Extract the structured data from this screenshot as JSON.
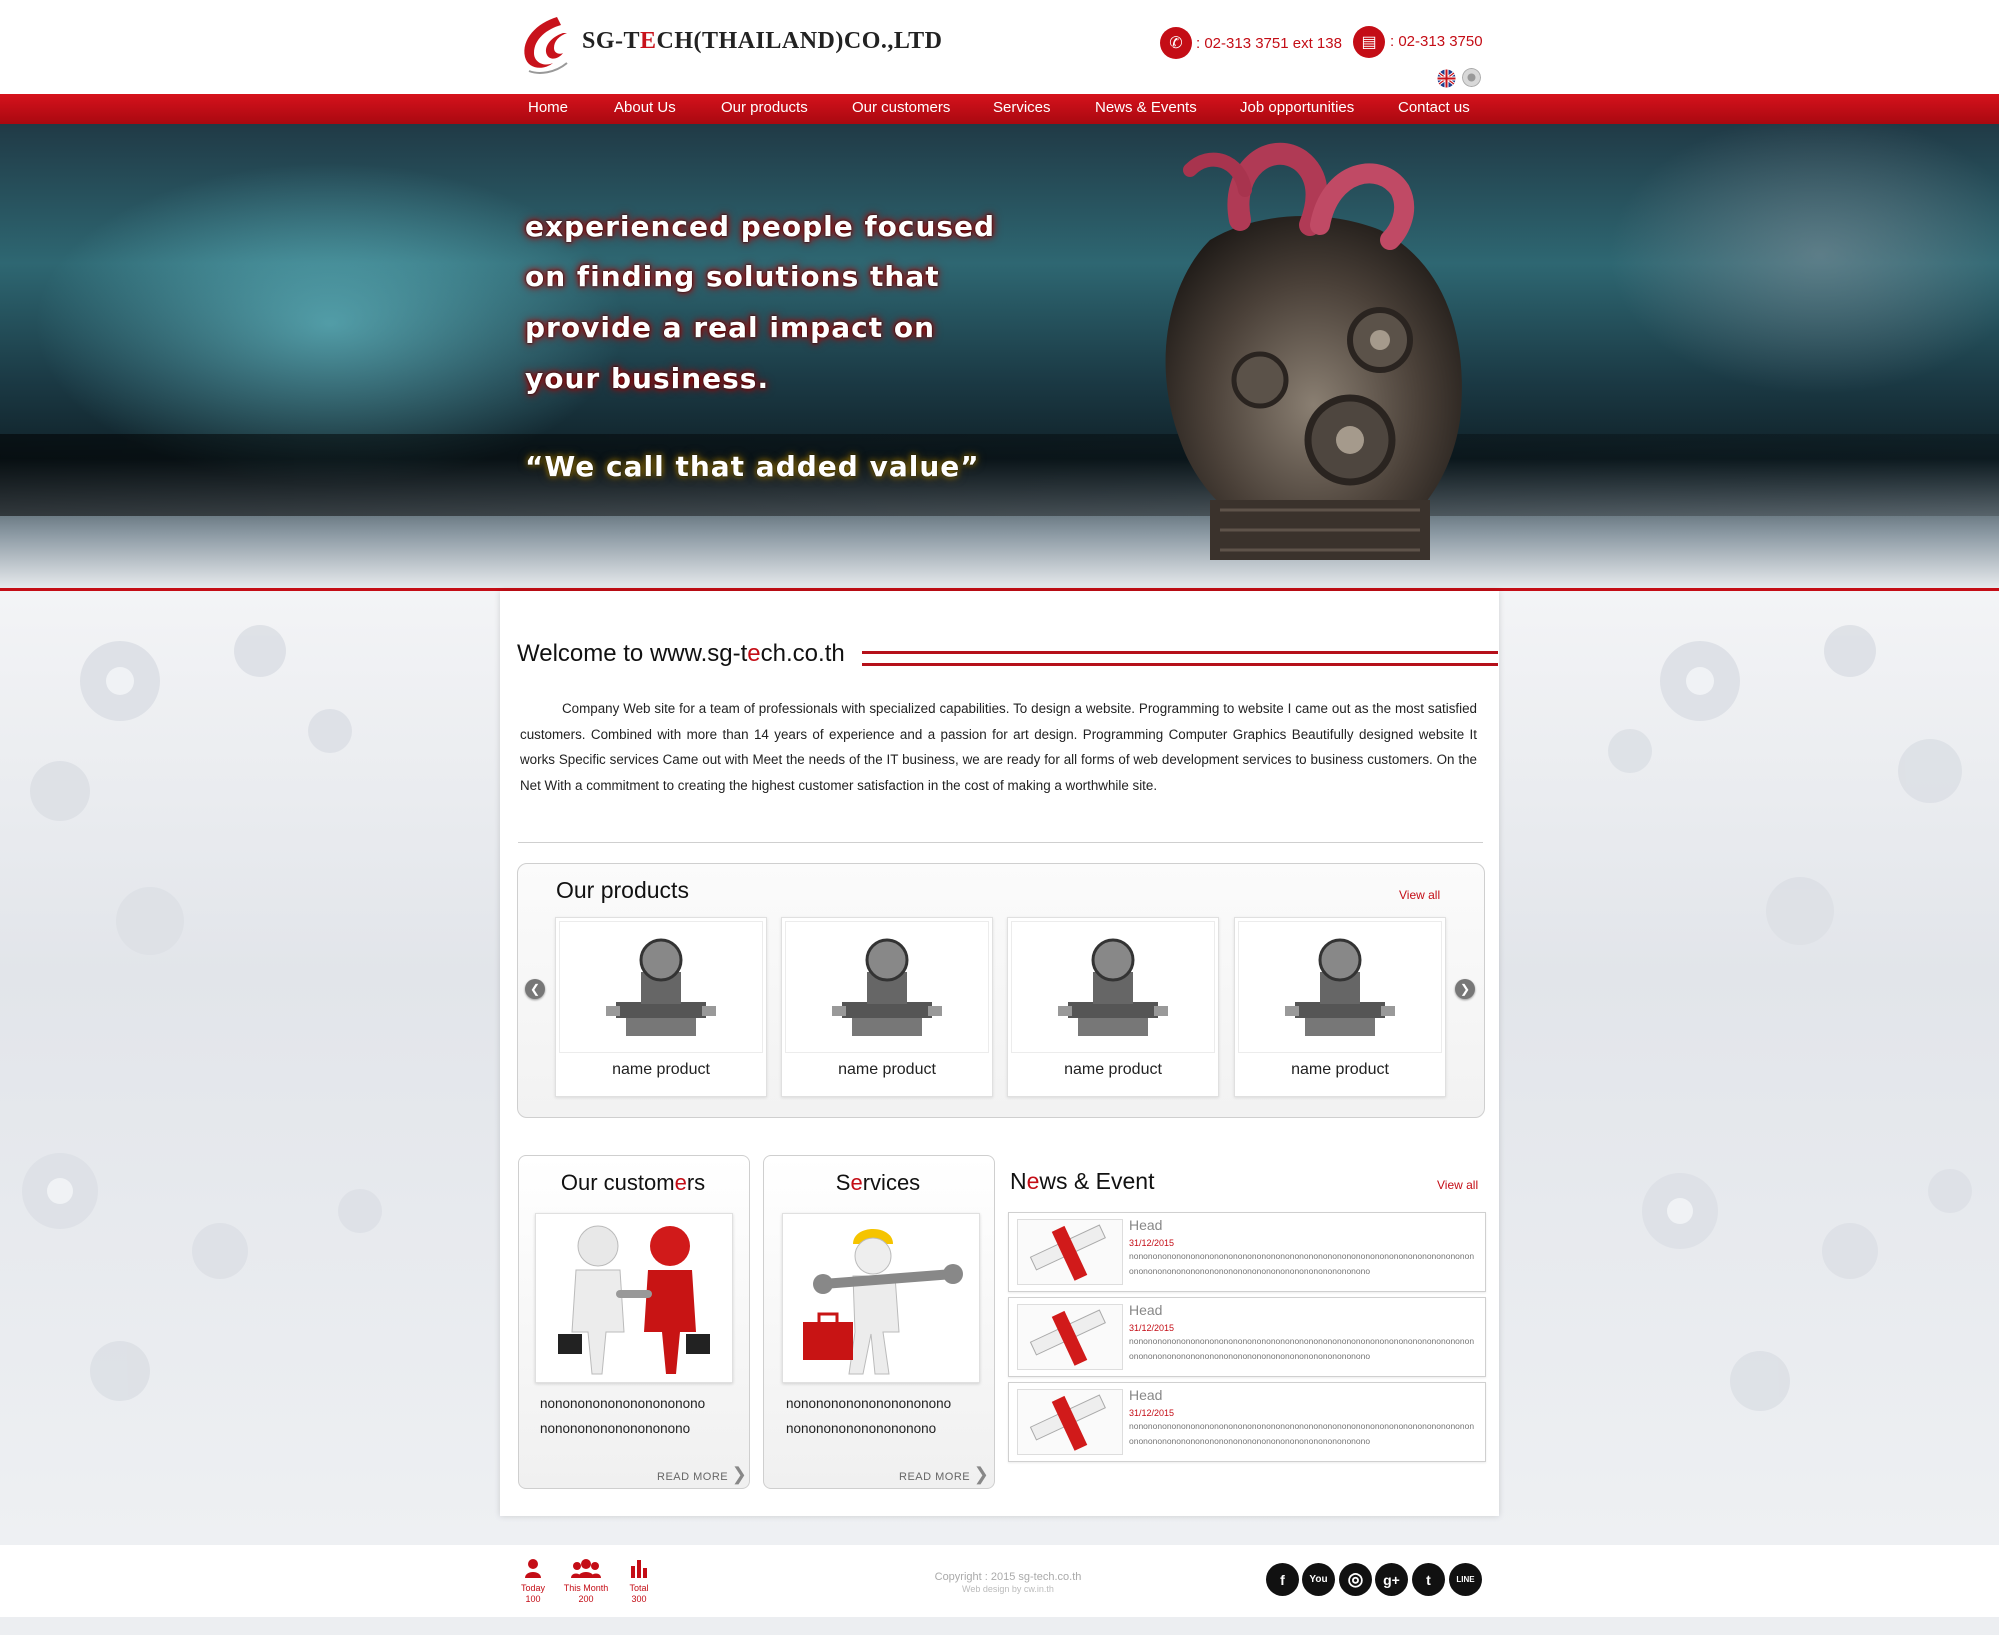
{
  "header": {
    "logo_text_pre": "SG-T",
    "logo_text_e": "E",
    "logo_text_post": "CH(THAILAND)CO.,LTD",
    "phone": ": 02-313 3751 ext 138",
    "fax": ": 02-313 3750"
  },
  "nav": {
    "items": [
      "Home",
      "About Us",
      "Our products",
      "Our customers",
      "Services",
      "News & Events",
      "Job opportunities",
      "Contact us"
    ]
  },
  "hero": {
    "lines": [
      "experienced people focused",
      "on finding solutions that",
      "provide a real impact on",
      "your business."
    ],
    "tagline": "“We call that added value”"
  },
  "welcome": {
    "title_pre": "Welcome to www.sg-t",
    "title_e": "e",
    "title_post": "ch.co.th",
    "body": "Company Web site for a team of professionals with specialized capabilities. To design a website. Programming to website I came out as the most satisfied customers. Combined with more than 14 years of experience and a passion for art design. Programming Computer Graphics Beautifully designed website It works Specific services Came out with Meet the needs of the IT business, we are ready for all forms of web development services to business customers. On the Net With a commitment to creating the highest customer satisfaction in the cost of making a worthwhile site."
  },
  "products": {
    "title": "Our products",
    "view_all": "View all",
    "items": [
      "name  product",
      "name  product",
      "name  product",
      "name  product"
    ]
  },
  "customers": {
    "title_pre": "Our custom",
    "title_e": "e",
    "title_post": "rs",
    "text_line1": "nonononononononononono",
    "text_line2": "nononononononononono",
    "read_more": "READ MORE"
  },
  "services": {
    "title_pre": "S",
    "title_e": "e",
    "title_post": "rvices",
    "text_line1": "nonononononononononono",
    "text_line2": "nononononononononono",
    "read_more": "READ MORE"
  },
  "news": {
    "title_pre": "N",
    "title_e": "e",
    "title_post": "ws & Event",
    "view_all": "View all",
    "items": [
      {
        "head": "Head",
        "date": "31/12/2015",
        "desc": "nononononononononononononononononononononononononononononononononononononononononononononononononononononononononononononono"
      },
      {
        "head": "Head",
        "date": "31/12/2015",
        "desc": "nononononononononononononononononononononononononononononononononononononononononononononononononononononononononononononono"
      },
      {
        "head": "Head",
        "date": "31/12/2015",
        "desc": "nononononononononononononononononononononononononononononononononononononononononononononononononononononononononononononono"
      }
    ]
  },
  "footer": {
    "stats": [
      {
        "label": "Today",
        "value": "100"
      },
      {
        "label": "This Month",
        "value": "200"
      },
      {
        "label": "Total",
        "value": "300"
      }
    ],
    "copyright": "Copyright : 2015 sg-tech.co.th",
    "webdesign": "Web design by cw.in.th",
    "social": [
      {
        "icon": "facebook-icon",
        "glyph": "f"
      },
      {
        "icon": "youtube-icon",
        "glyph": "You"
      },
      {
        "icon": "instagram-icon",
        "glyph": "◎"
      },
      {
        "icon": "googleplus-icon",
        "glyph": "g+"
      },
      {
        "icon": "twitter-icon",
        "glyph": "t"
      },
      {
        "icon": "line-icon",
        "glyph": "LINE"
      }
    ]
  },
  "colors": {
    "brand_red": "#c40d16",
    "nav_red": "#d6121c"
  }
}
